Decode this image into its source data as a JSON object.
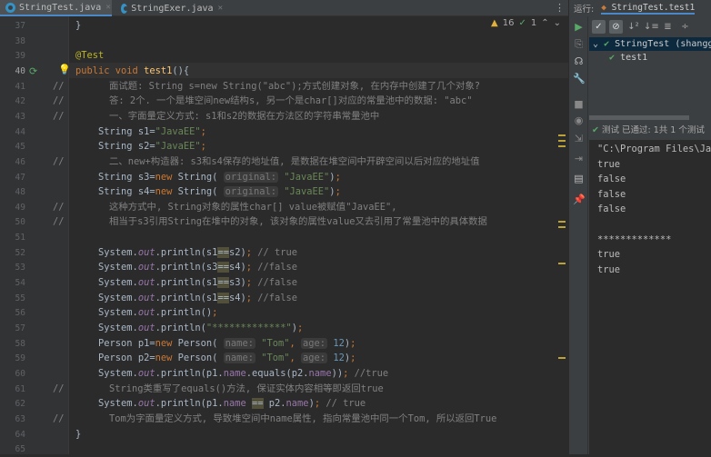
{
  "tabs": [
    {
      "label": "StringTest.java",
      "active": true
    },
    {
      "label": "StringExer.java",
      "active": false
    }
  ],
  "inspections": {
    "warnings": "16",
    "ok": "1"
  },
  "editor": {
    "current_line": 40,
    "lines": [
      {
        "n": 37,
        "t": [
          [
            "p",
            "}"
          ]
        ]
      },
      {
        "n": 38,
        "t": []
      },
      {
        "n": 39,
        "t": [
          [
            "ann",
            "@Test"
          ]
        ]
      },
      {
        "n": 40,
        "t": [
          [
            "kw",
            "public void "
          ],
          [
            "fn",
            "test1"
          ],
          [
            "p",
            "(){"
          ]
        ]
      },
      {
        "n": 41,
        "c": true,
        "t": [
          [
            "cmt",
            "面试题: String s=new String(\"abc\");方式创建对象, 在内存中创建了几个对象?"
          ]
        ]
      },
      {
        "n": 42,
        "c": true,
        "t": [
          [
            "cmt",
            "答: 2个. 一个是堆空间new结构s, 另一个是char[]对应的常量池中的数据: \"abc\""
          ]
        ]
      },
      {
        "n": 43,
        "c": true,
        "t": [
          [
            "cmt",
            "一、字面量定义方式: s1和s2的数据在方法区的字符串常量池中"
          ]
        ]
      },
      {
        "n": 44,
        "t": [
          [
            "p",
            "    String s1="
          ],
          [
            "str",
            "\"JavaEE\""
          ],
          [
            "kw",
            ";"
          ]
        ]
      },
      {
        "n": 45,
        "t": [
          [
            "p",
            "    String s2="
          ],
          [
            "str",
            "\"JavaEE\""
          ],
          [
            "kw",
            ";"
          ]
        ]
      },
      {
        "n": 46,
        "c": true,
        "t": [
          [
            "cmt",
            "二、new+构造器: s3和s4保存的地址值, 是数据在堆空间中开辟空间以后对应的地址值"
          ]
        ]
      },
      {
        "n": 47,
        "t": [
          [
            "p",
            "    String s3="
          ],
          [
            "kw",
            "new "
          ],
          [
            "p",
            "String( "
          ],
          [
            "hint",
            "original:"
          ],
          [
            "p",
            " "
          ],
          [
            "str",
            "\"JavaEE\""
          ],
          [
            "p",
            ")"
          ],
          [
            "kw",
            ";"
          ]
        ]
      },
      {
        "n": 48,
        "t": [
          [
            "p",
            "    String s4="
          ],
          [
            "kw",
            "new "
          ],
          [
            "p",
            "String( "
          ],
          [
            "hint",
            "original:"
          ],
          [
            "p",
            " "
          ],
          [
            "str",
            "\"JavaEE\""
          ],
          [
            "p",
            ")"
          ],
          [
            "kw",
            ";"
          ]
        ]
      },
      {
        "n": 49,
        "c": true,
        "t": [
          [
            "cmt",
            "这种方式中, String对象的属性char[] value被赋值\"JavaEE\","
          ]
        ]
      },
      {
        "n": 50,
        "c": true,
        "t": [
          [
            "cmt",
            "相当于s3引用String在堆中的对象, 该对象的属性value又去引用了常量池中的具体数据"
          ]
        ]
      },
      {
        "n": 51,
        "t": []
      },
      {
        "n": 52,
        "t": [
          [
            "p",
            "    System."
          ],
          [
            "fld",
            "out"
          ],
          [
            "p",
            ".println(s1"
          ],
          [
            "hl",
            "=="
          ],
          [
            "p",
            "s2)"
          ],
          [
            "kw",
            ";"
          ],
          [
            "cmt",
            " // true"
          ]
        ]
      },
      {
        "n": 53,
        "t": [
          [
            "p",
            "    System."
          ],
          [
            "fld",
            "out"
          ],
          [
            "p",
            ".println(s3"
          ],
          [
            "hl",
            "=="
          ],
          [
            "p",
            "s4)"
          ],
          [
            "kw",
            ";"
          ],
          [
            "cmt",
            " //false"
          ]
        ]
      },
      {
        "n": 54,
        "t": [
          [
            "p",
            "    System."
          ],
          [
            "fld",
            "out"
          ],
          [
            "p",
            ".println(s1"
          ],
          [
            "hl",
            "=="
          ],
          [
            "p",
            "s3)"
          ],
          [
            "kw",
            ";"
          ],
          [
            "cmt",
            " //false"
          ]
        ]
      },
      {
        "n": 55,
        "t": [
          [
            "p",
            "    System."
          ],
          [
            "fld",
            "out"
          ],
          [
            "p",
            ".println(s1"
          ],
          [
            "hl",
            "=="
          ],
          [
            "p",
            "s4)"
          ],
          [
            "kw",
            ";"
          ],
          [
            "cmt",
            " //false"
          ]
        ]
      },
      {
        "n": 56,
        "t": [
          [
            "p",
            "    System."
          ],
          [
            "fld",
            "out"
          ],
          [
            "p",
            ".println()"
          ],
          [
            "kw",
            ";"
          ]
        ]
      },
      {
        "n": 57,
        "t": [
          [
            "p",
            "    System."
          ],
          [
            "fld",
            "out"
          ],
          [
            "p",
            ".println("
          ],
          [
            "str",
            "\"*************\""
          ],
          [
            "p",
            ")"
          ],
          [
            "kw",
            ";"
          ]
        ]
      },
      {
        "n": 58,
        "t": [
          [
            "p",
            "    Person p1="
          ],
          [
            "kw",
            "new "
          ],
          [
            "p",
            "Person( "
          ],
          [
            "hint",
            "name:"
          ],
          [
            "p",
            " "
          ],
          [
            "str",
            "\"Tom\""
          ],
          [
            "kw",
            ", "
          ],
          [
            "hint",
            "age:"
          ],
          [
            "p",
            " "
          ],
          [
            "num",
            "12"
          ],
          [
            "p",
            ")"
          ],
          [
            "kw",
            ";"
          ]
        ]
      },
      {
        "n": 59,
        "t": [
          [
            "p",
            "    Person p2="
          ],
          [
            "kw",
            "new "
          ],
          [
            "p",
            "Person( "
          ],
          [
            "hint",
            "name:"
          ],
          [
            "p",
            " "
          ],
          [
            "str",
            "\"Tom\""
          ],
          [
            "kw",
            ", "
          ],
          [
            "hint",
            "age:"
          ],
          [
            "p",
            " "
          ],
          [
            "num",
            "12"
          ],
          [
            "p",
            ")"
          ],
          [
            "kw",
            ";"
          ]
        ]
      },
      {
        "n": 60,
        "t": [
          [
            "p",
            "    System."
          ],
          [
            "fld",
            "out"
          ],
          [
            "p",
            ".println(p1."
          ],
          [
            "fld2",
            "name"
          ],
          [
            "p",
            ".equals(p2."
          ],
          [
            "fld2",
            "name"
          ],
          [
            "p",
            "))"
          ],
          [
            "kw",
            ";"
          ],
          [
            "cmt",
            " //true"
          ]
        ]
      },
      {
        "n": 61,
        "c": true,
        "t": [
          [
            "cmt",
            "String类重写了equals()方法, 保证实体内容相等即返回true"
          ]
        ]
      },
      {
        "n": 62,
        "t": [
          [
            "p",
            "    System."
          ],
          [
            "fld",
            "out"
          ],
          [
            "p",
            ".println(p1."
          ],
          [
            "fld2",
            "name"
          ],
          [
            "p",
            " "
          ],
          [
            "hl",
            "=="
          ],
          [
            "p",
            " p2."
          ],
          [
            "fld2",
            "name"
          ],
          [
            "p",
            ")"
          ],
          [
            "kw",
            ";"
          ],
          [
            "cmt",
            " // true"
          ]
        ]
      },
      {
        "n": 63,
        "c": true,
        "t": [
          [
            "cmt",
            "Tom为字面量定义方式, 导致堆空间中name属性, 指向常量池中同一个Tom, 所以返回True"
          ]
        ]
      },
      {
        "n": 64,
        "t": [
          [
            "p",
            "}"
          ]
        ]
      },
      {
        "n": 65,
        "t": []
      }
    ]
  },
  "run_panel": {
    "label": "运行:",
    "config": "StringTest.test1",
    "tree": [
      {
        "label": "StringTest (shanggu",
        "status": "passed"
      },
      {
        "label": "test1",
        "status": "passed"
      }
    ],
    "status": "测试 已通过: 1共 1 个测试",
    "console": [
      "\"C:\\Program Files\\Jav",
      "true",
      "false",
      "false",
      "false",
      "",
      "*************",
      "true",
      "true"
    ]
  },
  "colors": {
    "accent": "#4a88c7",
    "pass": "#59a869",
    "keyword": "#cc7832",
    "string": "#6a8759"
  }
}
